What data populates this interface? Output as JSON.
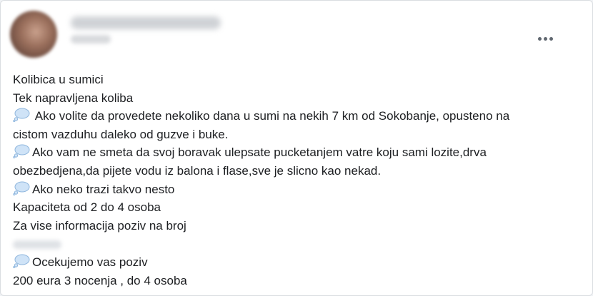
{
  "post": {
    "lines": [
      {
        "icon": false,
        "text": "Kolibica u sumici"
      },
      {
        "icon": false,
        "text": "Tek napravljena koliba"
      },
      {
        "icon": true,
        "text": " Ako volite da provedete nekoliko dana u sumi na nekih 7 km od Sokobanje, opusteno na"
      },
      {
        "icon": false,
        "text": "cistom vazduhu daleko od guzve i buke."
      },
      {
        "icon": true,
        "text": "Ako vam ne smeta da svoj boravak ulepsate pucketanjem vatre koju sami lozite,drva"
      },
      {
        "icon": false,
        "text": "obezbedjena,da pijete vodu iz  balona i  flase,sve je slicno kao nekad."
      },
      {
        "icon": true,
        "text": "Ako neko trazi takvo nesto"
      },
      {
        "icon": false,
        "text": "Kapaciteta od 2 do 4 osoba"
      },
      {
        "icon": false,
        "text": "Za vise informacija poziv na broj"
      },
      {
        "icon": true,
        "text": "Ocekujemo vas poziv"
      },
      {
        "icon": false,
        "text": "200 eura 3 nocenja , do 4 osoba"
      }
    ]
  },
  "icons": {
    "more": "more-horizontal-icon",
    "bubble": "thought-bubble-icon"
  },
  "colors": {
    "text": "#1c1e21",
    "bubble": "#cfe3f7",
    "bubble_stroke": "#8fb6dd"
  }
}
